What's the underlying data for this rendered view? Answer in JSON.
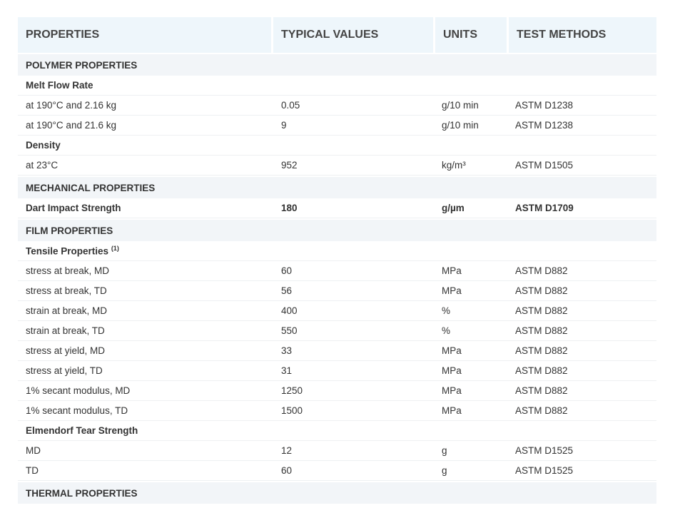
{
  "headers": [
    "PROPERTIES",
    "TYPICAL VALUES",
    "UNITS",
    "TEST METHODS"
  ],
  "rows": [
    {
      "type": "section",
      "label": "POLYMER PROPERTIES"
    },
    {
      "type": "sub",
      "label": "Melt Flow Rate"
    },
    {
      "type": "data",
      "label": "at 190°C and 2.16 kg",
      "value": "0.05",
      "unit": "g/10 min",
      "method": "ASTM D1238"
    },
    {
      "type": "data",
      "label": "at 190°C and 21.6 kg",
      "value": "9",
      "unit": "g/10 min",
      "method": "ASTM D1238"
    },
    {
      "type": "sub",
      "label": "Density"
    },
    {
      "type": "data",
      "label": "at 23°C",
      "value": "952",
      "unit": "kg/m³",
      "method": "ASTM D1505"
    },
    {
      "type": "section",
      "label": "MECHANICAL PROPERTIES"
    },
    {
      "type": "subdata",
      "label": "Dart Impact Strength",
      "value": "180",
      "unit": "g/µm",
      "method": "ASTM D1709"
    },
    {
      "type": "section",
      "label": "FILM PROPERTIES"
    },
    {
      "type": "sub",
      "label": "Tensile Properties",
      "note": "(1)"
    },
    {
      "type": "data",
      "label": "stress at break, MD",
      "value": "60",
      "unit": "MPa",
      "method": "ASTM D882"
    },
    {
      "type": "data",
      "label": "stress at break, TD",
      "value": "56",
      "unit": "MPa",
      "method": "ASTM D882"
    },
    {
      "type": "data",
      "label": "strain at break, MD",
      "value": "400",
      "unit": "%",
      "method": "ASTM D882"
    },
    {
      "type": "data",
      "label": "strain at break, TD",
      "value": "550",
      "unit": "%",
      "method": "ASTM D882"
    },
    {
      "type": "data",
      "label": "stress at yield, MD",
      "value": "33",
      "unit": "MPa",
      "method": "ASTM D882"
    },
    {
      "type": "data",
      "label": "stress at yield, TD",
      "value": "31",
      "unit": "MPa",
      "method": "ASTM D882"
    },
    {
      "type": "data",
      "label": "1% secant modulus, MD",
      "value": "1250",
      "unit": "MPa",
      "method": "ASTM D882"
    },
    {
      "type": "data",
      "label": "1% secant modulus, TD",
      "value": "1500",
      "unit": "MPa",
      "method": "ASTM D882"
    },
    {
      "type": "sub",
      "label": "Elmendorf Tear Strength"
    },
    {
      "type": "data",
      "label": "MD",
      "value": "12",
      "unit": "g",
      "method": "ASTM D1525"
    },
    {
      "type": "data",
      "label": "TD",
      "value": "60",
      "unit": "g",
      "method": "ASTM D1525"
    },
    {
      "type": "section",
      "label": "THERMAL PROPERTIES"
    }
  ]
}
